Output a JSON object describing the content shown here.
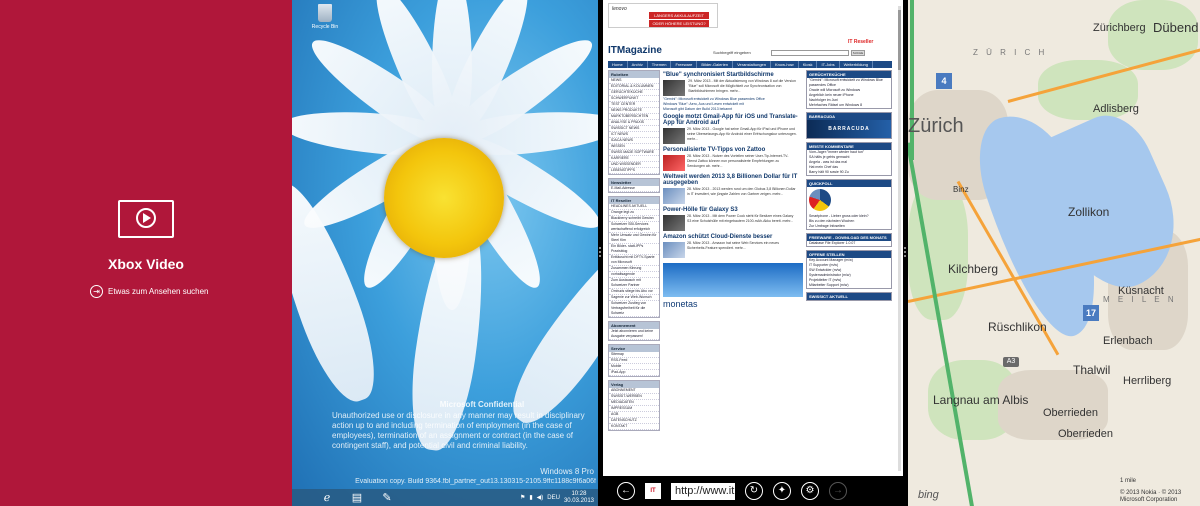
{
  "xbox": {
    "title": "Xbox Video",
    "browse_label": "Etwas zum Ansehen suchen",
    "background": "#b0173a"
  },
  "desktop": {
    "recycle_bin_label": "Recycle Bin",
    "confidential_title": "Microsoft Confidential",
    "confidential_text": "Unauthorized use or disclosure in any manner may result in disciplinary action up to and including termination of employment (in the case of employees), termination of an assignment or contract (in the case of contingent staff), and potential civil and criminal liability.",
    "os_name": "Windows 8 Pro",
    "build_text": "Evaluation copy. Build 9364.fbl_partner_out13.130315-2105.9ffc1188c9f6a06f",
    "taskbar": {
      "language": "DEU",
      "time": "10:28",
      "date": "30.03.2013"
    }
  },
  "browser": {
    "address": "http://www.it",
    "top_ad": {
      "brand": "lenovo",
      "line1": "LÄNGERS AKKULAUFZEIT",
      "line2": "ODER HÖHERE LEISTUNG?"
    },
    "site": {
      "logo": "ITMagazine",
      "reseller_logo": "IT Reseller",
      "search_label": "Suchbegriff eingeben",
      "search_button": "SUCHE",
      "nav": [
        "Home",
        "Archiv",
        "Themen",
        "Freeware",
        "Bilder-Galerien",
        "Veranstaltungen",
        "Know-how",
        "Kiosk",
        "IT-Jobs",
        "Weiterbildung"
      ],
      "left_boxes": [
        {
          "head": "Rubriken",
          "items": [
            "NEWS",
            "EDITORIAL & KOLUMNEN",
            "GERÜCHTEKÜCHE",
            "SCHWERPUNKT",
            "TEST CENTER",
            "NEWS PRODUKTE",
            "MARKTÜBERSICHTEN",
            "ANALYSE & PRAXIS",
            "SWISSICT NEWS",
            "ICT NEWS",
            "IDACA NEWS",
            "WISSEN",
            "SWISS MADE SOFTWARE",
            "KARRIERE",
            "UND WISSENDER",
            "LEBENSTIPPS"
          ]
        },
        {
          "head": "Newsletter",
          "items": [
            "E-Mail-Adresse"
          ]
        },
        {
          "head": "IT Reseller",
          "items": [
            "HEADLINES AKTUELL",
            "Orange legt zu",
            "Blackberry schreibt Gewinn",
            "Schweizer SBI-Services wertschaffend erfolgreich",
            "Mehr Umsatz und Gewinn für Steel Kim",
            "Ein Bilder- statt-IPPs Praxisblog",
            "Enttäuscht mit DFTV-Sparte von Microsoft",
            "Zusammen führung",
            "vorhaltsagende",
            "Zum Austausch mit Schweizer Partner",
            "Ombuds stiege bis Abo vor",
            "Sagenie zur Web-Wunsch",
            "Schweizer Zustieg von Vertragsfreiheit für die Schweiz"
          ]
        },
        {
          "head": "Abonnement",
          "items": [
            "Jetzt abonnieren und keine Ausgabe verpassen!"
          ]
        },
        {
          "head": "Service",
          "items": [
            "Sitemap",
            "RSS-Feed",
            "Mobile",
            "iPad-App"
          ]
        },
        {
          "head": "Verlag",
          "items": [
            "ABONNEMENT",
            "SWISSIT-WERBEN",
            "MEDIADATEN",
            "IMPRESSUM",
            "AGB",
            "DATENSCHUTZ",
            "KONTAKT"
          ]
        }
      ],
      "headline": "\"Blue\" synchronisiert Startbildschirme",
      "headline_text": "29. März 2013 - Mit der Aktualisierung von Windows 8 auf die Version \"Blue\" soll Microsoft die Möglichkeit zur Synchronisation von Startbildschirmen bringen. mehr...",
      "bullets": [
        "\"Gemini\": Microsoft entwickelt zu Windows Blue passendes Office",
        "Windows \"Blue\": Aero, Aus und Lesen entwickelt mit",
        "Microsoft gibt Datum der Build 2013 bekannt"
      ],
      "articles": [
        {
          "title": "Google motzt Gmail-App für iOS und Translate-App für Android auf",
          "text": "29. März 2013 - Google hat seine Gmail-App für iPad und iPhone und seine Übersetzungs-App für Android einer Erfrischungskur unterzogen. mehr..."
        },
        {
          "title": "Personalisierte TV-Tipps von Zattoo",
          "text": "28. März 2013 - Nutzer des Vorteilen seiner User-Tip-Internet-TV-Dienst Zattoo können nun personalisierte Empfehlungen zu Sendungen ab. mehr..."
        },
        {
          "title": "Weltweit werden 2013 3,8 Billionen Dollar für IT ausgegeben",
          "text": "28. März 2013 - 2013 werden rund um den Globus 3,8 Billionen Dollar in IT investiert, wie jüngste Zahlen von Gartner zeigen. mehr..."
        },
        {
          "title": "Power-Hölle für Galaxy S3",
          "text": "28. März 2013 - Mit dem Power Cook steht für Besitzer eines Galaxy S3 eine Schutzhülle mit eingebautem 2100-mAh-Akku bereit. mehr..."
        },
        {
          "title": "Amazon schützt Cloud-Dienste besser",
          "text": "28. März 2013 - Amazon hat seine Web Services ein neues Sicherheits-Feature spendiert. mehr..."
        }
      ],
      "monetas_ad": "monetas",
      "right_boxes": [
        {
          "head": "GERÜCHTEKÜCHE",
          "items": [
            "\"Gemini\": Microsoft entwickelt zu Windows Blue passendes Office",
            "Oracle will Microsoft zu Windows",
            "Angeblich kein neuer iPhone",
            "Nachfolger im Juni",
            "Mehrfaches Rätsel um Windows 8"
          ]
        },
        {
          "head": "BARRACUDA",
          "items": []
        },
        {
          "head": "MEISTE KOMMENTARE",
          "items": [
            "Vom-Jager:\"immer wieder haut tun\"",
            "SA hälts je gehts gemacht",
            "Angela - was ist das mal",
            "Hat mein Chef das",
            "Barry hält 90 sowie 90 Zu"
          ]
        },
        {
          "head": "QUICKPOLL",
          "items": [
            "Smartphone - Lieber gross oder klein?",
            "Bis zu den nächsten Wochen",
            "Zur Umfrage Infoseiten"
          ]
        },
        {
          "head": "FREEWARE - DOWNLOAD DES MONATS",
          "items": [
            "Database File Explorer 1.0.07"
          ]
        },
        {
          "head": "OFFENE STELLEN",
          "items": [
            "Key Account Manager (m/w)",
            "IT Supporter (m/w)",
            "SW Entwickler (m/w)",
            "Systemadministrator (m/w)",
            "Projektleiter IT (m/w)",
            "Mitarbeiter Support (m/w)"
          ]
        },
        {
          "head": "SWISSICT AKTUELL",
          "items": []
        }
      ]
    }
  },
  "map": {
    "labels": [
      "Zürichberg",
      "Dübend",
      "Zürich",
      "Z Ü R I C H",
      "Adlisberg",
      "Binz",
      "Zollikon",
      "Küsnacht",
      "Kilchberg",
      "Rüschlikon",
      "Erlenbach",
      "Thalwil",
      "Langnau am Albis",
      "Herrliberg",
      "Oberrieden",
      "Oberrieden",
      "M E I L E N",
      "Küsnacht"
    ],
    "pins": [
      "4",
      "17"
    ],
    "shield": "A3",
    "bing_logo": "bing",
    "copyright": "© 2013 Nokia · © 2013 Microsoft Corporation",
    "scale": "1 mile"
  }
}
